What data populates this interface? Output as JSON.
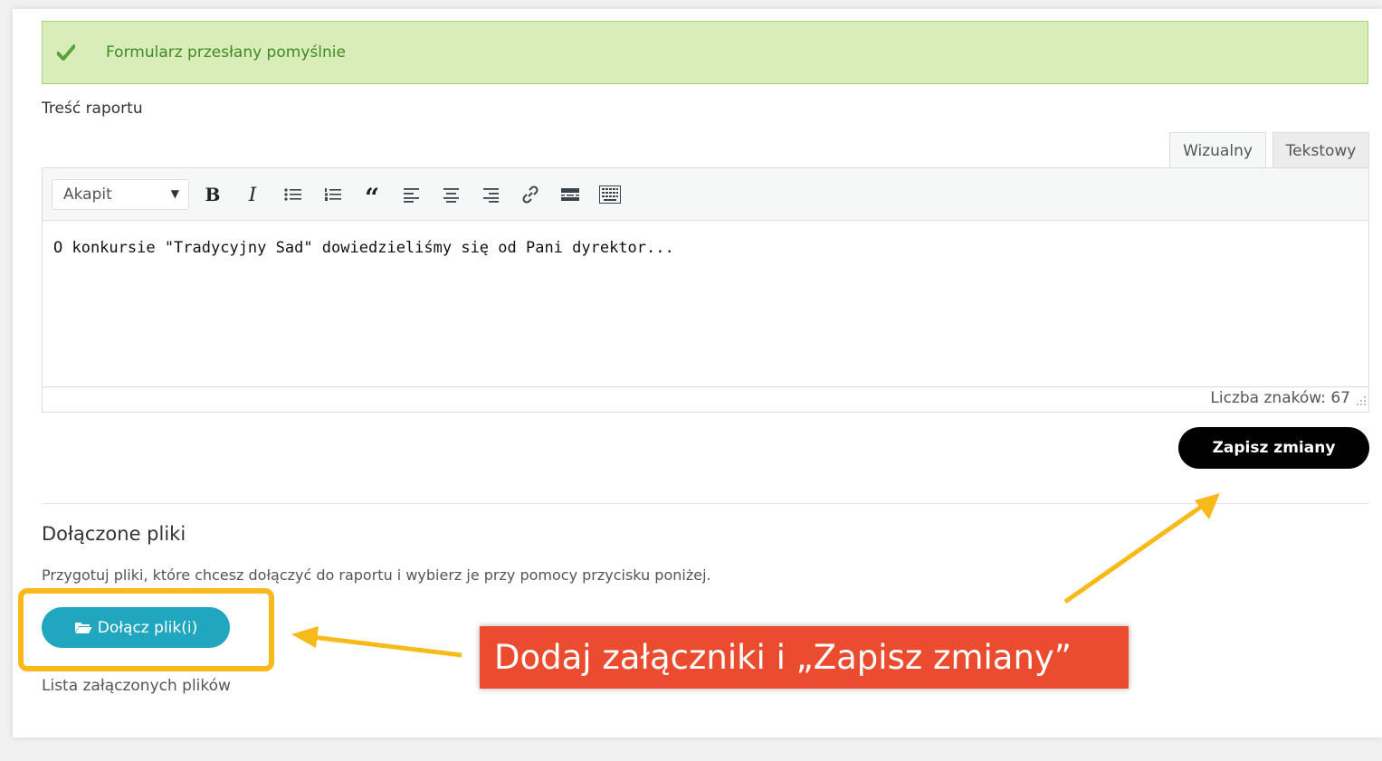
{
  "alert": {
    "message": "Formularz przesłany pomyślnie",
    "icon": "check-icon",
    "color": "#3e8a26"
  },
  "editor": {
    "label": "Treść raportu",
    "tabs": [
      {
        "label": "Wizualny"
      },
      {
        "label": "Tekstowy"
      }
    ],
    "format_select": {
      "value": "Akapit"
    },
    "toolbar_icons": [
      "bold-icon",
      "italic-icon",
      "bullet-list-icon",
      "numbered-list-icon",
      "blockquote-icon",
      "align-left-icon",
      "align-center-icon",
      "align-right-icon",
      "link-icon",
      "read-more-icon",
      "toolbar-toggle-icon"
    ],
    "content": "O konkursie \"Tradycyjny Sad\" dowiedzieliśmy się od Pani dyrektor...",
    "char_count": "Liczba znaków: 67"
  },
  "save_button": {
    "label": "Zapisz zmiany"
  },
  "attachments": {
    "title": "Dołączone pliki",
    "description": "Przygotuj pliki, które chcesz dołączyć do raportu i wybierz je przy pomocy przycisku poniżej.",
    "button_label": "Dołącz plik(i)",
    "list_label": "Lista załączonych plików"
  },
  "callout": {
    "text": "Dodaj załączniki i „Zapisz zmiany”",
    "color": "#eb4b2e"
  },
  "colors": {
    "highlight": "#f8b91a",
    "attach_button": "#20a6bf",
    "save_button": "#000000"
  }
}
